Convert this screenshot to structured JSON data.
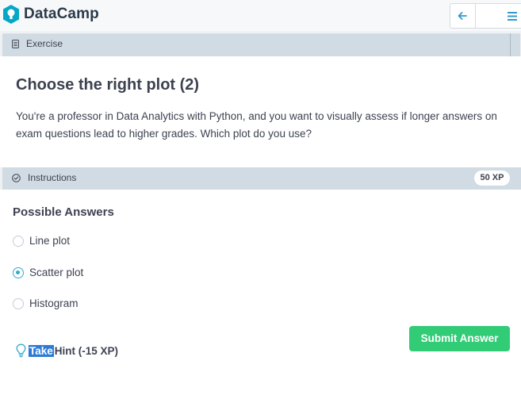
{
  "header": {
    "brand": "DataCamp",
    "back_icon": "arrow-left-icon",
    "menu_icon": "hamburger-menu-icon"
  },
  "exercise_section": {
    "label": "Exercise",
    "icon": "document-icon"
  },
  "exercise": {
    "title": "Choose the right plot (2)",
    "description": "You're a professor in Data Analytics with Python, and you want to visually assess if longer answers on exam questions lead to higher grades. Which plot do you use?"
  },
  "instructions_section": {
    "label": "Instructions",
    "icon": "check-circle-icon",
    "xp": "50 XP"
  },
  "answers": {
    "title": "Possible Answers",
    "options": [
      {
        "label": "Line plot",
        "selected": false
      },
      {
        "label": "Scatter plot",
        "selected": true
      },
      {
        "label": "Histogram",
        "selected": false
      }
    ]
  },
  "hint": {
    "take": "Take",
    "rest": "Hint (-15 XP)",
    "icon": "lightbulb-icon"
  },
  "submit_label": "Submit Answer",
  "colors": {
    "accent_green": "#32cc77",
    "accent_blue": "#33aacc",
    "section_bar": "#d1dbe3",
    "text": "#3d4251"
  }
}
